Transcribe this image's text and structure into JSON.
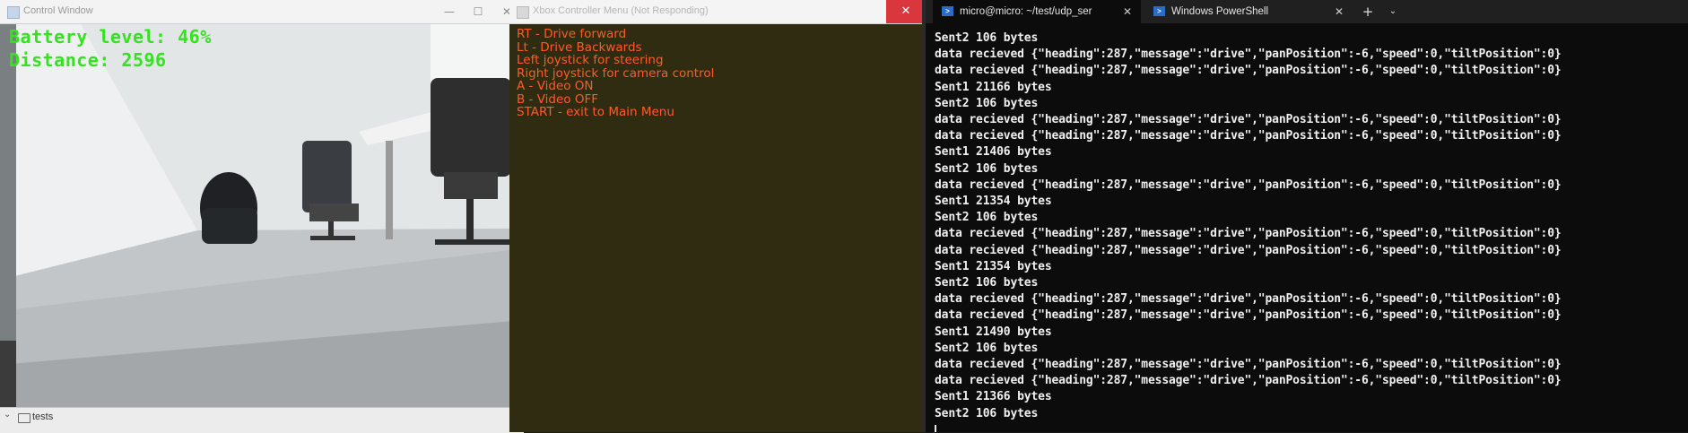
{
  "camera_window": {
    "title": "Control Window",
    "overlay": {
      "battery": "Battery level: 46%",
      "distance": "Distance: 2596"
    },
    "bottom_folder": "tests"
  },
  "menu_window": {
    "title": "Xbox Controller Menu (Not Responding)",
    "lines": [
      "RT - Drive forward",
      "Lt - Drive Backwards",
      "Left joystick for steering",
      "Right joystick for camera control",
      "A - Video ON",
      "B - Video OFF",
      "START - exit to Main Menu"
    ],
    "text_color": "#ff5a28"
  },
  "terminal": {
    "tabs": [
      {
        "label": "micro@micro: ~/test/udp_ser",
        "icon": "powershell-icon",
        "active": true
      },
      {
        "label": "Windows PowerShell",
        "icon": "powershell-icon",
        "active": false
      }
    ],
    "new_tab": "+",
    "dropdown": "⌄",
    "lines": [
      "Sent2 106 bytes",
      "data recieved {\"heading\":287,\"message\":\"drive\",\"panPosition\":-6,\"speed\":0,\"tiltPosition\":0}",
      "data recieved {\"heading\":287,\"message\":\"drive\",\"panPosition\":-6,\"speed\":0,\"tiltPosition\":0}",
      "Sent1 21166 bytes",
      "Sent2 106 bytes",
      "data recieved {\"heading\":287,\"message\":\"drive\",\"panPosition\":-6,\"speed\":0,\"tiltPosition\":0}",
      "data recieved {\"heading\":287,\"message\":\"drive\",\"panPosition\":-6,\"speed\":0,\"tiltPosition\":0}",
      "Sent1 21406 bytes",
      "Sent2 106 bytes",
      "data recieved {\"heading\":287,\"message\":\"drive\",\"panPosition\":-6,\"speed\":0,\"tiltPosition\":0}",
      "Sent1 21354 bytes",
      "Sent2 106 bytes",
      "data recieved {\"heading\":287,\"message\":\"drive\",\"panPosition\":-6,\"speed\":0,\"tiltPosition\":0}",
      "data recieved {\"heading\":287,\"message\":\"drive\",\"panPosition\":-6,\"speed\":0,\"tiltPosition\":0}",
      "Sent1 21354 bytes",
      "Sent2 106 bytes",
      "data recieved {\"heading\":287,\"message\":\"drive\",\"panPosition\":-6,\"speed\":0,\"tiltPosition\":0}",
      "data recieved {\"heading\":287,\"message\":\"drive\",\"panPosition\":-6,\"speed\":0,\"tiltPosition\":0}",
      "Sent1 21490 bytes",
      "Sent2 106 bytes",
      "data recieved {\"heading\":287,\"message\":\"drive\",\"panPosition\":-6,\"speed\":0,\"tiltPosition\":0}",
      "data recieved {\"heading\":287,\"message\":\"drive\",\"panPosition\":-6,\"speed\":0,\"tiltPosition\":0}",
      "Sent1 21366 bytes",
      "Sent2 106 bytes"
    ]
  },
  "colors": {
    "overlay_text": "#35e21f",
    "terminal_bg": "#0c0c0c",
    "close_button": "#d9363e"
  }
}
